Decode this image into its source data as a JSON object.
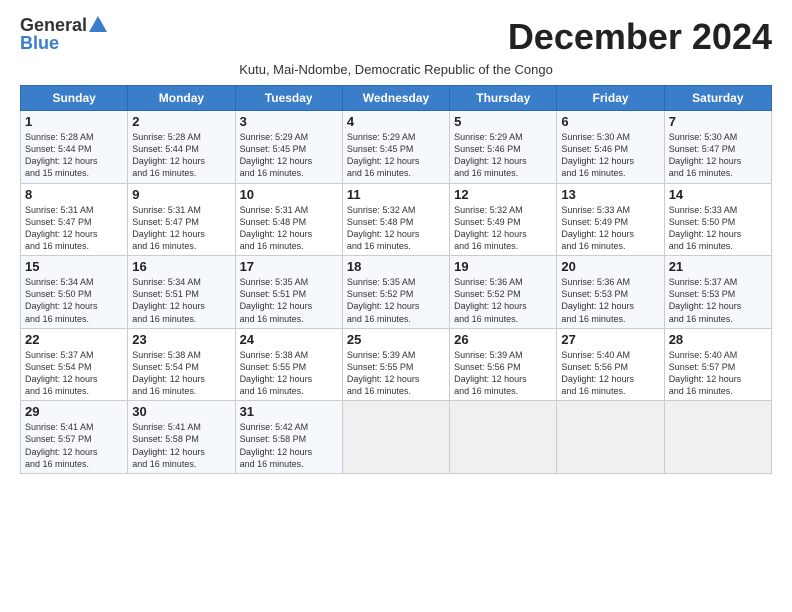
{
  "logo": {
    "general": "General",
    "blue": "Blue"
  },
  "title": "December 2024",
  "subtitle": "Kutu, Mai-Ndombe, Democratic Republic of the Congo",
  "days_of_week": [
    "Sunday",
    "Monday",
    "Tuesday",
    "Wednesday",
    "Thursday",
    "Friday",
    "Saturday"
  ],
  "weeks": [
    [
      {
        "day": "1",
        "sunrise": "5:28 AM",
        "sunset": "5:44 PM",
        "daylight": "12 hours and 15 minutes."
      },
      {
        "day": "2",
        "sunrise": "5:28 AM",
        "sunset": "5:44 PM",
        "daylight": "12 hours and 16 minutes."
      },
      {
        "day": "3",
        "sunrise": "5:29 AM",
        "sunset": "5:45 PM",
        "daylight": "12 hours and 16 minutes."
      },
      {
        "day": "4",
        "sunrise": "5:29 AM",
        "sunset": "5:45 PM",
        "daylight": "12 hours and 16 minutes."
      },
      {
        "day": "5",
        "sunrise": "5:29 AM",
        "sunset": "5:46 PM",
        "daylight": "12 hours and 16 minutes."
      },
      {
        "day": "6",
        "sunrise": "5:30 AM",
        "sunset": "5:46 PM",
        "daylight": "12 hours and 16 minutes."
      },
      {
        "day": "7",
        "sunrise": "5:30 AM",
        "sunset": "5:47 PM",
        "daylight": "12 hours and 16 minutes."
      }
    ],
    [
      {
        "day": "8",
        "sunrise": "5:31 AM",
        "sunset": "5:47 PM",
        "daylight": "12 hours and 16 minutes."
      },
      {
        "day": "9",
        "sunrise": "5:31 AM",
        "sunset": "5:47 PM",
        "daylight": "12 hours and 16 minutes."
      },
      {
        "day": "10",
        "sunrise": "5:31 AM",
        "sunset": "5:48 PM",
        "daylight": "12 hours and 16 minutes."
      },
      {
        "day": "11",
        "sunrise": "5:32 AM",
        "sunset": "5:48 PM",
        "daylight": "12 hours and 16 minutes."
      },
      {
        "day": "12",
        "sunrise": "5:32 AM",
        "sunset": "5:49 PM",
        "daylight": "12 hours and 16 minutes."
      },
      {
        "day": "13",
        "sunrise": "5:33 AM",
        "sunset": "5:49 PM",
        "daylight": "12 hours and 16 minutes."
      },
      {
        "day": "14",
        "sunrise": "5:33 AM",
        "sunset": "5:50 PM",
        "daylight": "12 hours and 16 minutes."
      }
    ],
    [
      {
        "day": "15",
        "sunrise": "5:34 AM",
        "sunset": "5:50 PM",
        "daylight": "12 hours and 16 minutes."
      },
      {
        "day": "16",
        "sunrise": "5:34 AM",
        "sunset": "5:51 PM",
        "daylight": "12 hours and 16 minutes."
      },
      {
        "day": "17",
        "sunrise": "5:35 AM",
        "sunset": "5:51 PM",
        "daylight": "12 hours and 16 minutes."
      },
      {
        "day": "18",
        "sunrise": "5:35 AM",
        "sunset": "5:52 PM",
        "daylight": "12 hours and 16 minutes."
      },
      {
        "day": "19",
        "sunrise": "5:36 AM",
        "sunset": "5:52 PM",
        "daylight": "12 hours and 16 minutes."
      },
      {
        "day": "20",
        "sunrise": "5:36 AM",
        "sunset": "5:53 PM",
        "daylight": "12 hours and 16 minutes."
      },
      {
        "day": "21",
        "sunrise": "5:37 AM",
        "sunset": "5:53 PM",
        "daylight": "12 hours and 16 minutes."
      }
    ],
    [
      {
        "day": "22",
        "sunrise": "5:37 AM",
        "sunset": "5:54 PM",
        "daylight": "12 hours and 16 minutes."
      },
      {
        "day": "23",
        "sunrise": "5:38 AM",
        "sunset": "5:54 PM",
        "daylight": "12 hours and 16 minutes."
      },
      {
        "day": "24",
        "sunrise": "5:38 AM",
        "sunset": "5:55 PM",
        "daylight": "12 hours and 16 minutes."
      },
      {
        "day": "25",
        "sunrise": "5:39 AM",
        "sunset": "5:55 PM",
        "daylight": "12 hours and 16 minutes."
      },
      {
        "day": "26",
        "sunrise": "5:39 AM",
        "sunset": "5:56 PM",
        "daylight": "12 hours and 16 minutes."
      },
      {
        "day": "27",
        "sunrise": "5:40 AM",
        "sunset": "5:56 PM",
        "daylight": "12 hours and 16 minutes."
      },
      {
        "day": "28",
        "sunrise": "5:40 AM",
        "sunset": "5:57 PM",
        "daylight": "12 hours and 16 minutes."
      }
    ],
    [
      {
        "day": "29",
        "sunrise": "5:41 AM",
        "sunset": "5:57 PM",
        "daylight": "12 hours and 16 minutes."
      },
      {
        "day": "30",
        "sunrise": "5:41 AM",
        "sunset": "5:58 PM",
        "daylight": "12 hours and 16 minutes."
      },
      {
        "day": "31",
        "sunrise": "5:42 AM",
        "sunset": "5:58 PM",
        "daylight": "12 hours and 16 minutes."
      },
      null,
      null,
      null,
      null
    ]
  ],
  "labels": {
    "sunrise": "Sunrise:",
    "sunset": "Sunset:",
    "daylight": "Daylight:"
  }
}
